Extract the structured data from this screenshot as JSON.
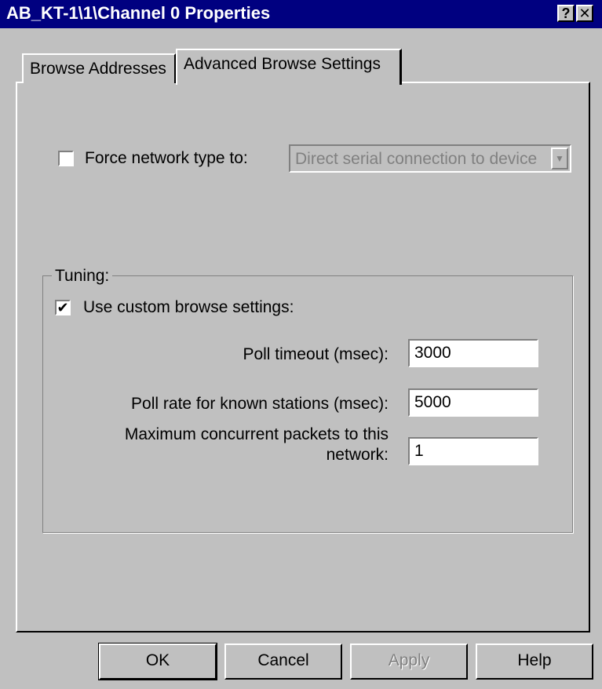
{
  "window": {
    "title": "AB_KT-1\\1\\Channel 0 Properties",
    "help_button": "?",
    "close_button": "✕"
  },
  "tabs": [
    {
      "label": "Browse Addresses",
      "active": false
    },
    {
      "label": "Advanced Browse Settings",
      "active": true
    }
  ],
  "force_network": {
    "checked": false,
    "label": "Force network type to:",
    "dropdown_value": "Direct serial connection to device",
    "dropdown_enabled": false
  },
  "tuning": {
    "legend": "Tuning:",
    "custom_checked": true,
    "custom_label": "Use custom browse settings:",
    "poll_timeout_label": "Poll timeout (msec):",
    "poll_timeout_value": "3000",
    "poll_rate_label": "Poll rate for known stations (msec):",
    "poll_rate_value": "5000",
    "max_packets_label_line1": "Maximum concurrent packets to this",
    "max_packets_label_line2": "network:",
    "max_packets_value": "1"
  },
  "buttons": {
    "ok": "OK",
    "cancel": "Cancel",
    "apply": "Apply",
    "help": "Help"
  },
  "colors": {
    "titlebar": "#000080",
    "face": "#c0c0c0"
  }
}
